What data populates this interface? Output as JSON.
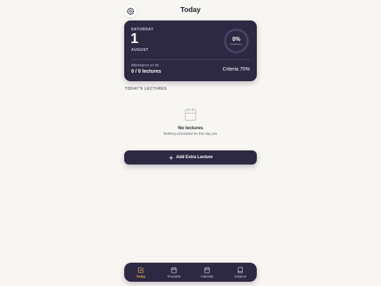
{
  "header": {
    "title": "Today",
    "settings_icon": "gear-icon"
  },
  "summary": {
    "day_name": "SATURDAY",
    "day_number": "1",
    "month": "AUGUST",
    "overall_percent": "0%",
    "overall_label": "OVERALL",
    "overall_fraction": 0,
    "attendance_label": "Attendance so far",
    "attendance_value": "0 / 0 lectures",
    "criteria": "Criteria 75%"
  },
  "lectures": {
    "section_title": "TODAY'S LECTURES",
    "empty_icon": "calendar-icon",
    "empty_title": "No lectures",
    "empty_subtitle": "Nothing scheduled for this day yet."
  },
  "actions": {
    "add_extra_label": "Add Extra Lecture",
    "add_icon": "plus-icon"
  },
  "nav": {
    "items": [
      {
        "label": "Today",
        "icon": "check-square-icon",
        "active": true
      },
      {
        "label": "Timetable",
        "icon": "calendar-icon",
        "active": false
      },
      {
        "label": "Calendar",
        "icon": "calendar-icon",
        "active": false
      },
      {
        "label": "Subjects",
        "icon": "book-icon",
        "active": false
      }
    ]
  },
  "colors": {
    "background": "#f8f6f2",
    "card": "#2d2943",
    "accent_active": "#f1b84a",
    "text_dark": "#1f1d2b"
  }
}
